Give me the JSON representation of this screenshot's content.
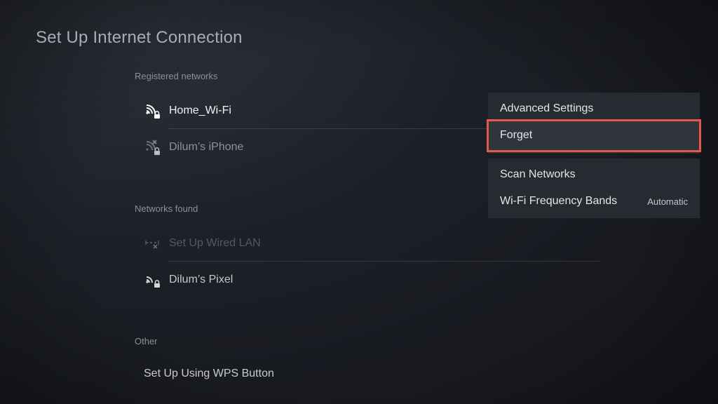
{
  "page": {
    "title": "Set Up Internet Connection"
  },
  "sections": {
    "registered_label": "Registered networks",
    "found_label": "Networks found",
    "other_label": "Other"
  },
  "registered_networks": [
    {
      "name": "Home_Wi-Fi",
      "icon": "wifi-locked-icon",
      "state": "connected"
    },
    {
      "name": "Dilum’s iPhone",
      "icon": "wifi-unavailable-locked-icon",
      "state": "unavailable"
    }
  ],
  "found_networks": [
    {
      "name": "Set Up Wired LAN",
      "icon": "lan-disconnected-icon",
      "state": "disabled"
    },
    {
      "name": "Dilum’s Pixel",
      "icon": "wifi-locked-icon",
      "state": "available"
    }
  ],
  "other": {
    "wps_label": "Set Up Using WPS Button"
  },
  "options_menu": {
    "group1": [
      {
        "label": "Advanced Settings"
      },
      {
        "label": "Forget",
        "focused": true
      }
    ],
    "group2": [
      {
        "label": "Scan Networks"
      },
      {
        "label": "Wi-Fi Frequency Bands",
        "value": "Automatic"
      }
    ]
  },
  "colors": {
    "focus_outline": "#e5594c",
    "panel_bg": "#262a31",
    "background": "#1d2027"
  }
}
